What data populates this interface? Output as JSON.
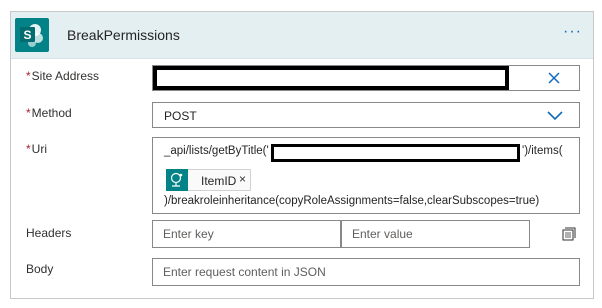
{
  "action": {
    "title": "BreakPermissions",
    "more_label": "···",
    "accent_color": "#038387",
    "icon": "sharepoint-logo-icon"
  },
  "fields": {
    "site_address": {
      "required": "*",
      "label": "Site Address",
      "value": "",
      "value_redacted": true
    },
    "method": {
      "required": "*",
      "label": "Method",
      "value": "POST"
    },
    "uri": {
      "required": "*",
      "label": "Uri",
      "prefix": "_api/lists/getByTitle('",
      "list_title_redacted": true,
      "after_title": "')/items(",
      "token": {
        "label": "ItemID",
        "remove": "×",
        "icon": "dynamic-content-icon"
      },
      "suffix": ")/breakroleinheritance(copyRoleAssignments=false,clearSubscopes=true)"
    },
    "headers": {
      "label": "Headers",
      "key_placeholder": "Enter key",
      "value_placeholder": "Enter value"
    },
    "body": {
      "label": "Body",
      "placeholder": "Enter request content in JSON"
    }
  }
}
